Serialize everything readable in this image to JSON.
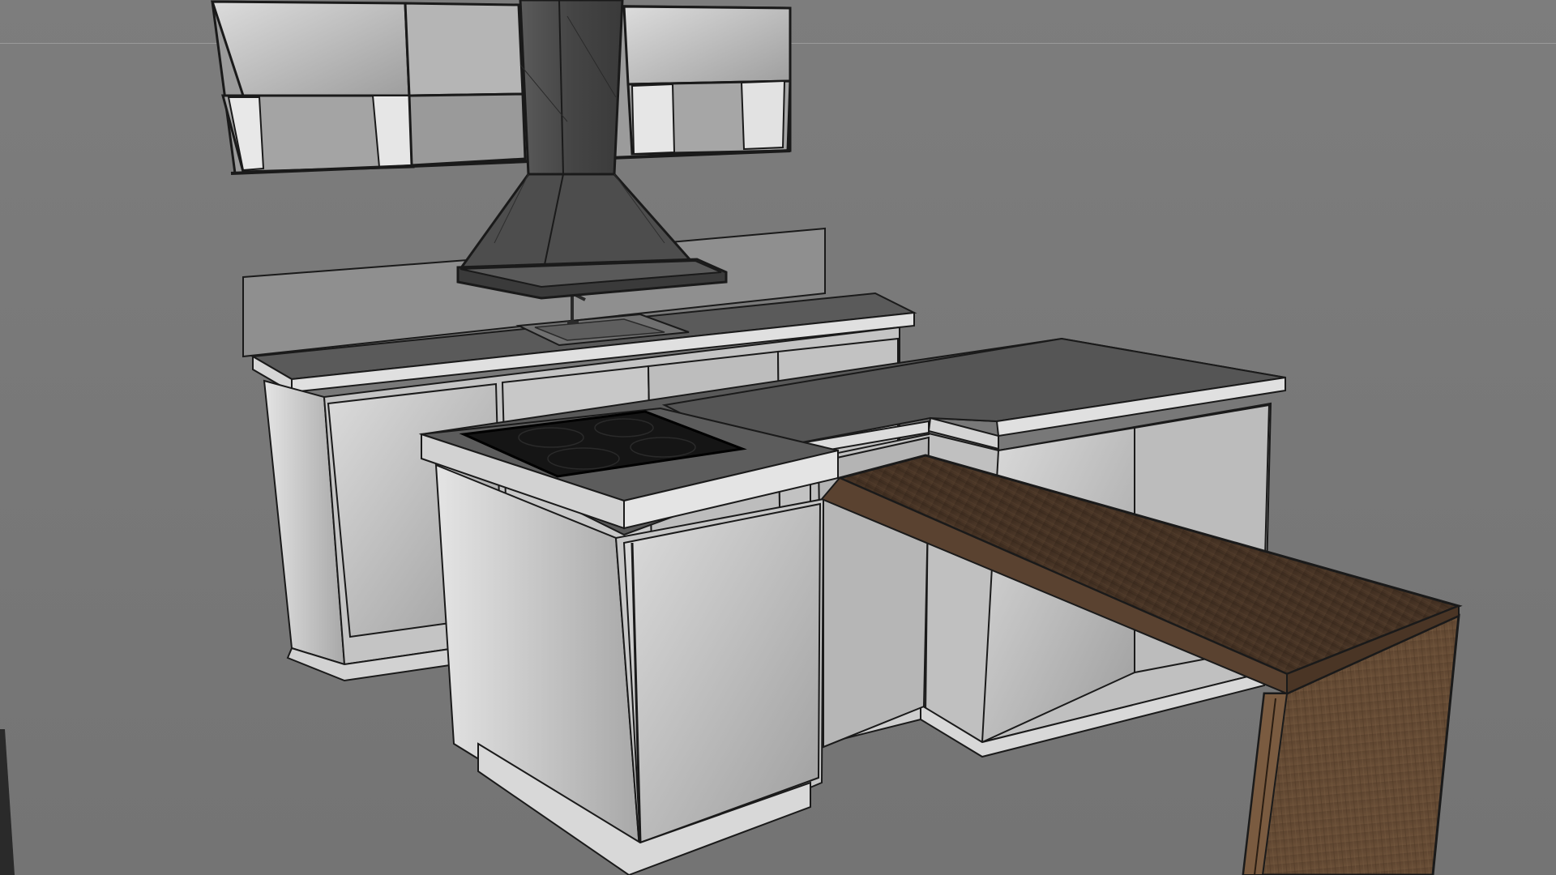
{
  "viewport": {
    "background_color": "#7a7a7a",
    "horizon_line_color": "#9a9a9a"
  },
  "materials": {
    "cabinet_white": "#d9d9d9",
    "cabinet_shade": "#b8b8b8",
    "countertop": "#595959",
    "countertop_edge": "#e2e2e2",
    "hood_metal": "#4a4a4a",
    "cooktop_glass": "#151515",
    "wood_bar": "#4a3626",
    "outline": "#1a1a1a"
  },
  "objects": [
    "wall-cabinets",
    "range-hood",
    "back-counter",
    "sink",
    "faucet",
    "island-counter",
    "cooktop",
    "wood-bar-table"
  ]
}
